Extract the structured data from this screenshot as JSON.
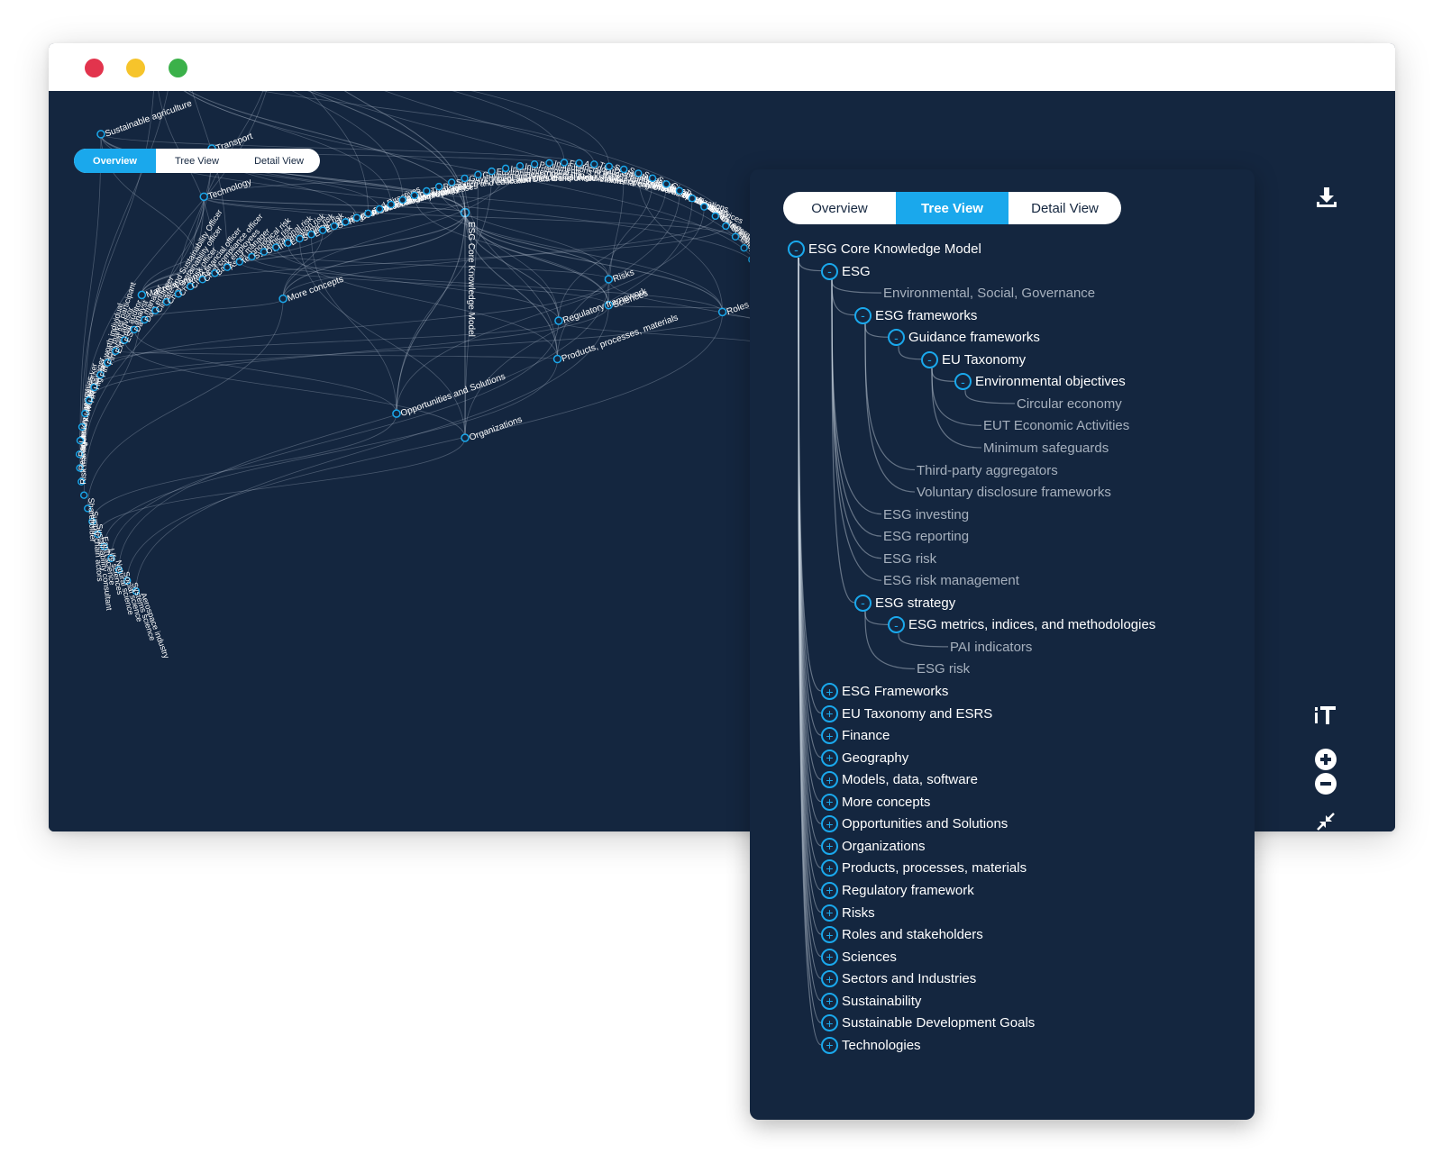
{
  "window": {
    "controls": [
      "close",
      "minimize",
      "maximize"
    ]
  },
  "view_tabs": [
    "Overview",
    "Tree View",
    "Detail View"
  ],
  "main_view": {
    "active_tab": "Overview"
  },
  "tree_panel": {
    "active_tab": "Tree View"
  },
  "toolbar": {
    "download_icon": "download-icon",
    "text_size_icon": "text-size-icon",
    "zoom_in_icon": "zoom-in-icon",
    "zoom_out_icon": "zoom-out-icon",
    "collapse_icon": "collapse-arrows-icon"
  },
  "colors": {
    "background": "#14263f",
    "accent": "#1aa8ec",
    "text": "#ffffff",
    "muted_text": "#a6b0bd"
  },
  "overview": {
    "root": "ESG Core Knowledge Model",
    "branches": [
      "Sciences",
      "Roles and stakeholders",
      "Risks",
      "Regulatory framework",
      "Products, processes, materials",
      "Organizations",
      "Opportunities and Solutions",
      "More concepts",
      "Macroeconomics",
      "Technology",
      "Transport",
      "Sustainability",
      "Sustainable agriculture",
      "Sustainable food system",
      "Aquaculture"
    ],
    "leaves": [
      "Aerospace industry",
      "Systems science",
      "Social science",
      "Natural science",
      "Life sciences",
      "Earth science",
      "Sustainability consultant",
      "Supply chain actors",
      "Shareholder",
      "Risk manager",
      "Researchers",
      "Regulatory agency",
      "Local communities",
      "Knowledge worker",
      "Investor",
      "HR manager",
      "High-net-worth individual",
      "Financial market participant",
      "Financial advisor",
      "External auditor",
      "ESG analyst",
      "Data manager",
      "Data engineer",
      "Climate and Sustainability Officer",
      "Chief sustainability officer",
      "Chief risk officer",
      "Chief financial officer",
      "Chief compliance officer",
      "Bank employees",
      "Asset manager",
      "Technological risk",
      "Systemic risk",
      "Operational risk",
      "Information risk",
      "Economic risk",
      "Strategic risk",
      "ESG risk",
      "Eco label",
      "Standards and Directives",
      "Regulations and laws",
      "Codes of conduct",
      "Product categories",
      "Materials and resources",
      "Financial products",
      "Business processes",
      "Technology",
      "Think tanks",
      "Research and education",
      "Software, Media and Data Companies",
      "Government agencies of the United States",
      "Government agencies",
      "Environmental NGOs",
      "Intergovernmental organizations",
      "International non-governmental organizations",
      "Parliaments",
      "Institutions of the European Union",
      "Financial firms",
      "Associations and Standards organizations",
      "TCFD opportunities",
      "Sustainable products and services",
      "Sustainable transport and services",
      "Sustainable fashion",
      "Sustainable finance",
      "Circular economy",
      "Transport",
      "Renewable energies",
      "Green technologies",
      "Clean energy",
      "Sustainable consumption",
      "Energy efficiency",
      "Pulp and paper industry",
      "Real estate industry",
      "Retail industry",
      "Shipping industry",
      "Software industry",
      "Steel industry",
      "Case Studies",
      "Climate",
      "ETF Classes"
    ]
  },
  "tree": [
    {
      "label": "ESG Core Knowledge Model",
      "depth": 0,
      "state": "expanded"
    },
    {
      "label": "ESG",
      "depth": 1,
      "state": "expanded"
    },
    {
      "label": "Environmental, Social, Governance",
      "depth": 2,
      "state": "leaf"
    },
    {
      "label": "ESG frameworks",
      "depth": 2,
      "state": "expanded"
    },
    {
      "label": "Guidance frameworks",
      "depth": 3,
      "state": "expanded"
    },
    {
      "label": "EU Taxonomy",
      "depth": 4,
      "state": "expanded"
    },
    {
      "label": "Environmental objectives",
      "depth": 5,
      "state": "expanded"
    },
    {
      "label": "Circular economy",
      "depth": 6,
      "state": "leaf"
    },
    {
      "label": "EUT Economic Activities",
      "depth": 5,
      "state": "leaf"
    },
    {
      "label": "Minimum safeguards",
      "depth": 5,
      "state": "leaf"
    },
    {
      "label": "Third-party aggregators",
      "depth": 3,
      "state": "leaf"
    },
    {
      "label": "Voluntary disclosure frameworks",
      "depth": 3,
      "state": "leaf"
    },
    {
      "label": "ESG investing",
      "depth": 2,
      "state": "leaf"
    },
    {
      "label": "ESG reporting",
      "depth": 2,
      "state": "leaf"
    },
    {
      "label": "ESG risk",
      "depth": 2,
      "state": "leaf"
    },
    {
      "label": "ESG risk management",
      "depth": 2,
      "state": "leaf"
    },
    {
      "label": "ESG strategy",
      "depth": 2,
      "state": "expanded"
    },
    {
      "label": "ESG metrics, indices, and methodologies",
      "depth": 3,
      "state": "expanded"
    },
    {
      "label": "PAI indicators",
      "depth": 4,
      "state": "leaf"
    },
    {
      "label": "ESG risk",
      "depth": 3,
      "state": "leaf"
    },
    {
      "label": "ESG Frameworks",
      "depth": 1,
      "state": "collapsed"
    },
    {
      "label": "EU Taxonomy and ESRS",
      "depth": 1,
      "state": "collapsed"
    },
    {
      "label": "Finance",
      "depth": 1,
      "state": "collapsed"
    },
    {
      "label": "Geography",
      "depth": 1,
      "state": "collapsed"
    },
    {
      "label": "Models, data, software",
      "depth": 1,
      "state": "collapsed"
    },
    {
      "label": "More concepts",
      "depth": 1,
      "state": "collapsed"
    },
    {
      "label": "Opportunities and Solutions",
      "depth": 1,
      "state": "collapsed"
    },
    {
      "label": "Organizations",
      "depth": 1,
      "state": "collapsed"
    },
    {
      "label": "Products, processes, materials",
      "depth": 1,
      "state": "collapsed"
    },
    {
      "label": "Regulatory framework",
      "depth": 1,
      "state": "collapsed"
    },
    {
      "label": "Risks",
      "depth": 1,
      "state": "collapsed"
    },
    {
      "label": "Roles and stakeholders",
      "depth": 1,
      "state": "collapsed"
    },
    {
      "label": "Sciences",
      "depth": 1,
      "state": "collapsed"
    },
    {
      "label": "Sectors and Industries",
      "depth": 1,
      "state": "collapsed"
    },
    {
      "label": "Sustainability",
      "depth": 1,
      "state": "collapsed"
    },
    {
      "label": "Sustainable Development Goals",
      "depth": 1,
      "state": "collapsed"
    },
    {
      "label": "Technologies",
      "depth": 1,
      "state": "collapsed"
    }
  ]
}
